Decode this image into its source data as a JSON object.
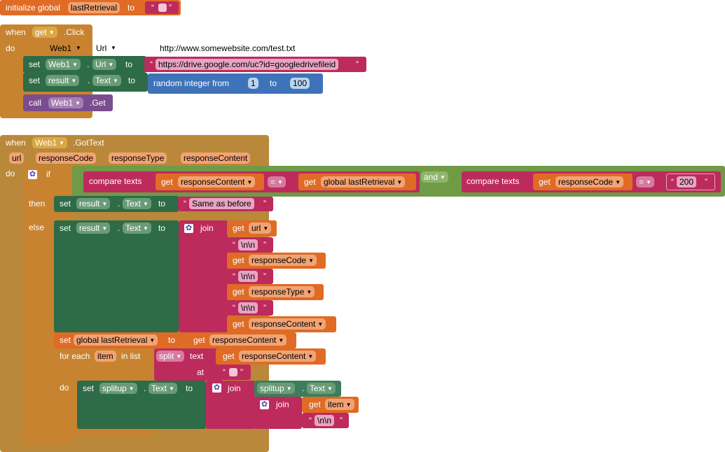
{
  "init": {
    "label": "initialize global",
    "var": "lastRetrieval",
    "to": "to"
  },
  "click_block": {
    "when": "when",
    "component": "get",
    "event": ".Click",
    "do": "do",
    "ghost": {
      "component": "Web1",
      "prop": "Url",
      "value": "http://www.somewebsite.com/test.txt"
    },
    "set1": {
      "set": "set",
      "component": "Web1",
      "dot": ".",
      "prop": "Url",
      "to": "to",
      "value": "https://drive.google.com/uc?id=googledrivefileid"
    },
    "set2": {
      "set": "set",
      "component": "result",
      "dot": ".",
      "prop": "Text",
      "to": "to",
      "random": "random integer from",
      "from": "1",
      "to_word": "to",
      "max": "100"
    },
    "call": {
      "call": "call",
      "component": "Web1",
      "method": ".Get"
    }
  },
  "gottext_block": {
    "when": "when",
    "component": "Web1",
    "event": ".GotText",
    "params": [
      "url",
      "responseCode",
      "responseType",
      "responseContent"
    ],
    "do": "do",
    "if": "if",
    "then": "then",
    "else": "else",
    "cond1": {
      "compare": "compare texts",
      "get": "get",
      "var": "responseContent",
      "op": "=",
      "var2": "global lastRetrieval"
    },
    "and": "and",
    "cond2": {
      "compare": "compare texts",
      "get": "get",
      "var": "responseCode",
      "op": "=",
      "value": "200"
    },
    "then_set": {
      "set": "set",
      "component": "result",
      "dot": ".",
      "prop": "Text",
      "to": "to",
      "value": "Same as before"
    },
    "else_set": {
      "set": "set",
      "component": "result",
      "dot": ".",
      "prop": "Text",
      "to": "to",
      "join": "join"
    },
    "join_items": [
      {
        "type": "get",
        "label": "get",
        "var": "url"
      },
      {
        "type": "str",
        "value": "\\n\\n"
      },
      {
        "type": "get",
        "label": "get",
        "var": "responseCode"
      },
      {
        "type": "str",
        "value": "\\n\\n"
      },
      {
        "type": "get",
        "label": "get",
        "var": "responseType"
      },
      {
        "type": "str",
        "value": "\\n\\n"
      },
      {
        "type": "get",
        "label": "get",
        "var": "responseContent"
      }
    ],
    "set_global": {
      "set": "set",
      "var": "global lastRetrieval",
      "to": "to",
      "get": "get",
      "value": "responseContent"
    },
    "foreach": {
      "label": "for each",
      "var": "item",
      "in_list": "in list",
      "split": "split",
      "text": "text",
      "get": "get",
      "value": "responseContent",
      "at": "at",
      "do": "do"
    },
    "inner_set": {
      "set": "set",
      "component": "splitup",
      "dot": ".",
      "prop": "Text",
      "to": "to",
      "join": "join",
      "comp2": "splitup",
      "prop2": "Text",
      "join2": "join",
      "get": "get",
      "item": "item",
      "str": "\\n\\n"
    }
  }
}
